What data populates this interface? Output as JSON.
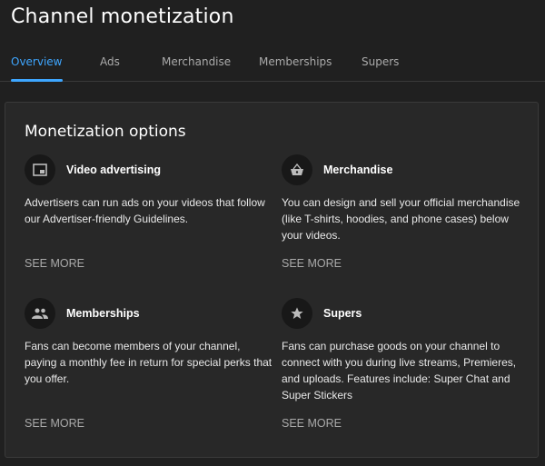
{
  "header": {
    "title": "Channel monetization"
  },
  "tabs": [
    {
      "label": "Overview",
      "active": true
    },
    {
      "label": "Ads"
    },
    {
      "label": "Merchandise"
    },
    {
      "label": "Memberships"
    },
    {
      "label": "Supers"
    }
  ],
  "accent": "#3ea6ff",
  "card": {
    "title": "Monetization options",
    "options": [
      {
        "icon": "video-ad-icon",
        "name": "Video advertising",
        "description": "Advertisers can run ads on your videos that follow our Advertiser-friendly Guidelines.",
        "action": "SEE MORE"
      },
      {
        "icon": "basket-icon",
        "name": "Merchandise",
        "description": "You can design and sell your official merchandise (like T-shirts, hoodies, and phone cases) below your videos.",
        "action": "SEE MORE"
      },
      {
        "icon": "people-icon",
        "name": "Memberships",
        "description": "Fans can become members of your channel, paying a monthly fee in return for special perks that you offer.",
        "action": "SEE MORE"
      },
      {
        "icon": "star-icon",
        "name": "Supers",
        "description": "Fans can purchase goods on your channel to connect with you during live streams, Premieres, and uploads. Features include: Super Chat and Super Stickers",
        "action": "SEE MORE"
      }
    ]
  }
}
